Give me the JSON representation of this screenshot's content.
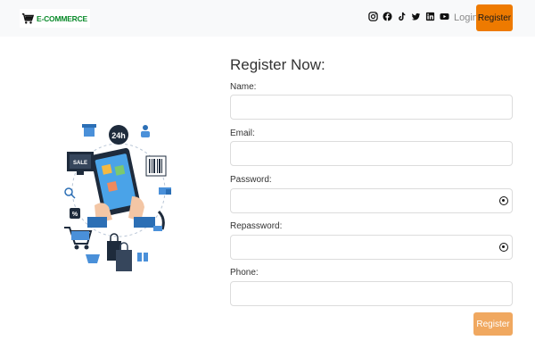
{
  "brand": {
    "name": "E-COMMERCE",
    "icon": "cart-icon",
    "color": "#0a8a2a"
  },
  "nav": {
    "socials": [
      {
        "icon": "instagram-icon"
      },
      {
        "icon": "facebook-icon"
      },
      {
        "icon": "tiktok-icon"
      },
      {
        "icon": "twitter-icon"
      },
      {
        "icon": "linkedin-icon"
      },
      {
        "icon": "youtube-icon"
      }
    ],
    "login_label": "Login",
    "register_label": "Register",
    "register_color": "#ee7a00"
  },
  "illustration": {
    "icon": "ecommerce-illustration"
  },
  "form": {
    "title": "Register Now:",
    "fields": [
      {
        "label": "Name:",
        "value": "",
        "type": "text"
      },
      {
        "label": "Email:",
        "value": "",
        "type": "email"
      },
      {
        "label": "Password:",
        "value": "",
        "type": "password",
        "toggle_icon": "eye-icon"
      },
      {
        "label": "Repassword:",
        "value": "",
        "type": "password",
        "toggle_icon": "eye-icon"
      },
      {
        "label": "Phone:",
        "value": "",
        "type": "tel"
      }
    ],
    "submit_label": "Register",
    "submit_color": "#f0a860"
  }
}
